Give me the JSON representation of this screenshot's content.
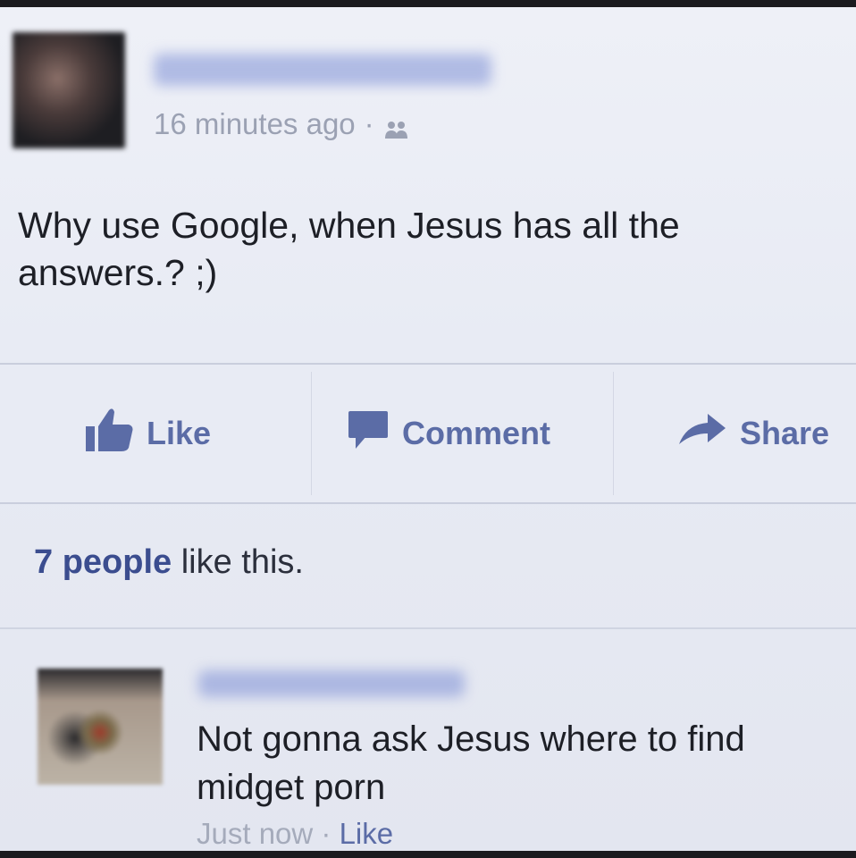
{
  "post": {
    "author_name": "",
    "timestamp": "16 minutes ago",
    "meta_separator": "·",
    "audience_icon": "friends-icon",
    "text": "Why use Google, when Jesus has all the answers.? ;)"
  },
  "actions": {
    "like_label": "Like",
    "comment_label": "Comment",
    "share_label": "Share",
    "like_icon": "thumbs-up-icon",
    "comment_icon": "speech-bubble-icon",
    "share_icon": "share-arrow-icon"
  },
  "likes_summary": {
    "count_text": "7 people",
    "suffix": " like this."
  },
  "comment": {
    "commenter_name": "",
    "text": "Not gonna ask Jesus where to find midget porn",
    "timestamp": "Just now",
    "separator": " · ",
    "like_label": "Like"
  },
  "colors": {
    "link_blue": "#5b6ca6",
    "text_dark": "#1d1f26",
    "meta_gray": "#9ba1b3",
    "background": "#e8ebf4"
  }
}
